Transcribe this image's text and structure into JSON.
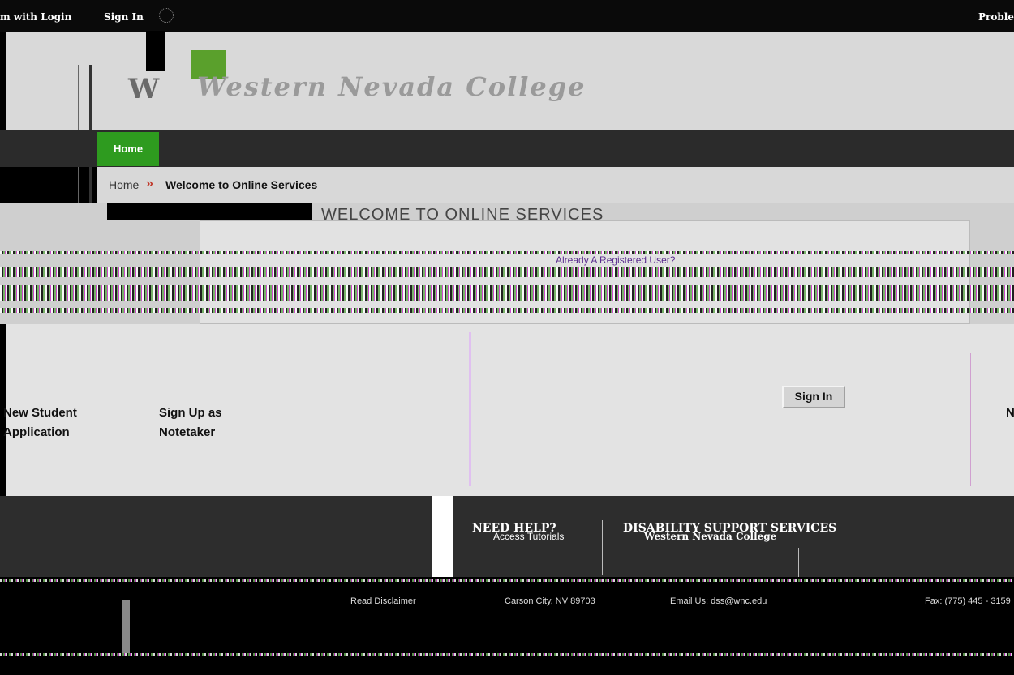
{
  "topbar": {
    "login_label": "m with Login",
    "signin_label": "Sign In",
    "right_label": "Proble"
  },
  "nav": {
    "home_label": "Home"
  },
  "breadcrumb": {
    "home": "Home",
    "separator": "»",
    "current": "Welcome to Online Services"
  },
  "page": {
    "heading": "WELCOME TO ONLINE SERVICES",
    "already_registered": "Already A Registered User?"
  },
  "main": {
    "link_new_student_line1": "New Student",
    "link_new_student_line2": "Application",
    "link_notetaker_line1": "Sign Up as",
    "link_notetaker_line2": "Notetaker",
    "signin_button": "Sign In",
    "right_edge_text": "N"
  },
  "footer": {
    "need_help_heading": "NEED HELP?",
    "access_tutorials": "Access Tutorials",
    "dss_heading": "DISABILITY SUPPORT SERVICES",
    "college_name": "Western Nevada College",
    "read_disclaimer": "Read Disclaimer",
    "address": "Carson City, NV 89703",
    "email": "Email Us: dss@wnc.edu",
    "fax": "Fax: (775) 445 - 3159"
  },
  "colors": {
    "nav_active": "#2e9b1f",
    "logo_green": "#5aa02c",
    "breadcrumb_separator": "#c0392b",
    "topbar_bg": "#0a0a0a"
  }
}
